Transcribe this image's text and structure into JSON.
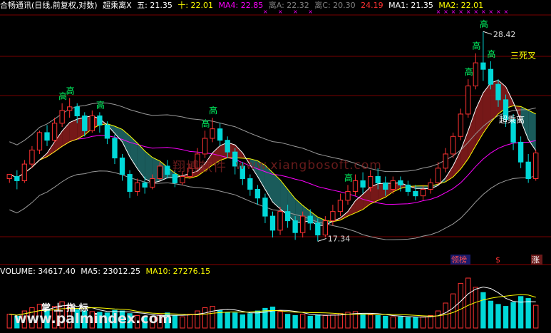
{
  "header": {
    "app_title": "合畅通讯(日线,前复权,对数)",
    "indicator_name": "超乘离X",
    "items": [
      {
        "label": "五: 21.35",
        "color": "#ffffff"
      },
      {
        "label": "十: 22.01",
        "color": "#ffff00"
      },
      {
        "label": "MA4: 22.85",
        "color": "#ff00ff"
      },
      {
        "label": "离A: 22.32",
        "color": "#808080"
      },
      {
        "label": "离C: 20.30",
        "color": "#808080"
      },
      {
        "label": "24.19",
        "color": "#ff3232"
      },
      {
        "label": "MA1: 21.35",
        "color": "#ffffff"
      },
      {
        "label": "MA2: 22.01",
        "color": "#ffff00"
      }
    ]
  },
  "annotations": {
    "high_marker": "高",
    "high_price": "28.42",
    "low_price": "17.34",
    "three_death_cross": "三死叉",
    "over_deviation": "超乘离",
    "tag_signal": "领榜",
    "tag_s": "$",
    "tag_rise": "涨"
  },
  "volume": {
    "label": "VOLUME: 34617.40",
    "ma5": "MA5: 23012.25",
    "ma10": "MA10: 27276.15"
  },
  "watermarks": {
    "software": "翔博软件",
    "url": "www.xiangbosoft.com",
    "bottom_cn": "掌 上 指 标",
    "bottom_url": "www.palmindex.com"
  },
  "colors": {
    "up": "#ff3232",
    "down": "#00d8d8",
    "ma_white": "#ffffff",
    "ma_yellow": "#ffff00",
    "ma_magenta": "#ff00ff",
    "band_gray": "#9a9a9a",
    "fill_red": "#8b1c1c",
    "fill_teal": "#1f6b6b"
  },
  "chart_data": {
    "type": "candlestick",
    "price_scale": "log",
    "ylim": [
      16.5,
      29.5
    ],
    "high": 28.42,
    "low": 17.34,
    "candles": [
      [
        20.1,
        20.3,
        19.9,
        20.2
      ],
      [
        20.2,
        20.0,
        19.6,
        20.5
      ],
      [
        20.0,
        20.8,
        19.9,
        21.0
      ],
      [
        20.8,
        21.5,
        20.6,
        21.7
      ],
      [
        21.5,
        22.4,
        21.3,
        22.5
      ],
      [
        22.4,
        22.0,
        21.7,
        22.8
      ],
      [
        22.0,
        22.9,
        21.9,
        23.2
      ],
      [
        22.9,
        23.6,
        22.7,
        24.0
      ],
      [
        23.6,
        23.8,
        23.2,
        24.3
      ],
      [
        23.8,
        23.3,
        22.9,
        24.0
      ],
      [
        23.3,
        22.5,
        22.2,
        23.5
      ],
      [
        22.5,
        23.3,
        22.4,
        23.6
      ],
      [
        23.3,
        22.8,
        22.4,
        23.5
      ],
      [
        22.8,
        22.1,
        21.8,
        23.0
      ],
      [
        22.1,
        21.1,
        20.8,
        22.3
      ],
      [
        21.1,
        20.3,
        20.0,
        21.3
      ],
      [
        20.3,
        19.5,
        19.2,
        20.5
      ],
      [
        19.5,
        19.9,
        19.3,
        20.1
      ],
      [
        19.9,
        19.7,
        19.4,
        20.2
      ],
      [
        19.7,
        20.1,
        19.6,
        20.3
      ],
      [
        20.1,
        20.7,
        20.0,
        20.9
      ],
      [
        20.7,
        20.3,
        20.1,
        21.0
      ],
      [
        20.3,
        19.9,
        19.7,
        20.5
      ],
      [
        19.9,
        20.2,
        19.8,
        20.4
      ],
      [
        20.2,
        20.6,
        20.1,
        20.8
      ],
      [
        20.6,
        21.3,
        20.5,
        21.6
      ],
      [
        21.3,
        22.1,
        21.1,
        22.5
      ],
      [
        22.1,
        22.6,
        21.9,
        23.2
      ],
      [
        22.6,
        22.0,
        21.7,
        22.9
      ],
      [
        22.0,
        21.4,
        21.1,
        22.2
      ],
      [
        21.4,
        20.7,
        20.3,
        21.6
      ],
      [
        20.7,
        20.1,
        19.8,
        20.9
      ],
      [
        20.1,
        19.6,
        19.3,
        20.3
      ],
      [
        19.6,
        19.2,
        18.9,
        19.8
      ],
      [
        19.2,
        18.4,
        18.1,
        19.4
      ],
      [
        18.4,
        17.8,
        17.5,
        18.6
      ],
      [
        17.8,
        18.6,
        17.6,
        18.8
      ],
      [
        18.6,
        18.2,
        17.9,
        18.9
      ],
      [
        18.2,
        17.7,
        17.4,
        18.4
      ],
      [
        17.7,
        18.4,
        17.5,
        18.6
      ],
      [
        18.4,
        18.1,
        17.8,
        18.7
      ],
      [
        18.1,
        17.6,
        17.34,
        18.3
      ],
      [
        17.6,
        18.2,
        17.5,
        18.4
      ],
      [
        18.2,
        18.6,
        18.0,
        18.9
      ],
      [
        18.6,
        19.1,
        18.4,
        19.4
      ],
      [
        19.1,
        19.5,
        18.9,
        19.8
      ],
      [
        19.5,
        20.0,
        19.3,
        20.3
      ],
      [
        20.0,
        19.7,
        19.4,
        20.4
      ],
      [
        19.7,
        20.2,
        19.5,
        20.5
      ],
      [
        20.2,
        19.9,
        19.6,
        20.6
      ],
      [
        19.9,
        19.6,
        19.3,
        20.2
      ],
      [
        19.6,
        20.0,
        19.4,
        20.2
      ],
      [
        20.0,
        19.8,
        19.5,
        20.2
      ],
      [
        19.8,
        19.5,
        19.3,
        20.0
      ],
      [
        19.5,
        19.3,
        19.1,
        19.8
      ],
      [
        19.3,
        19.6,
        19.1,
        19.8
      ],
      [
        19.6,
        19.9,
        19.4,
        20.1
      ],
      [
        19.9,
        20.6,
        19.8,
        20.9
      ],
      [
        20.6,
        21.3,
        20.4,
        21.6
      ],
      [
        21.3,
        22.2,
        21.1,
        22.4
      ],
      [
        22.2,
        23.4,
        22.0,
        23.7
      ],
      [
        23.4,
        25.0,
        23.2,
        25.4
      ],
      [
        25.0,
        26.4,
        24.8,
        27.0
      ],
      [
        26.4,
        26.0,
        25.3,
        28.42
      ],
      [
        26.0,
        25.1,
        24.8,
        26.5
      ],
      [
        25.1,
        24.2,
        23.8,
        25.4
      ],
      [
        24.2,
        23.1,
        22.7,
        24.5
      ],
      [
        23.1,
        21.9,
        21.5,
        23.4
      ],
      [
        21.9,
        20.9,
        20.6,
        22.2
      ],
      [
        20.9,
        20.1,
        19.9,
        21.3
      ],
      [
        20.1,
        21.35,
        20.0,
        21.5
      ]
    ],
    "series": [
      {
        "name": "五",
        "color": "#ffffff"
      },
      {
        "name": "十",
        "color": "#ffff00"
      },
      {
        "name": "MA4",
        "color": "#ff00ff"
      }
    ],
    "volume": [
      2100,
      1800,
      2600,
      3100,
      3600,
      2900,
      3300,
      4000,
      3500,
      2800,
      2600,
      2500,
      2400,
      2300,
      2700,
      2600,
      2200,
      1900,
      1700,
      1800,
      2000,
      2300,
      1900,
      1700,
      2100,
      2600,
      3100,
      3300,
      2700,
      2400,
      2300,
      2000,
      2200,
      2600,
      3000,
      3200,
      2500,
      2100,
      1900,
      2100,
      1800,
      2000,
      1900,
      2000,
      2200,
      2400,
      2500,
      2100,
      2000,
      1900,
      1800,
      1700,
      1700,
      1600,
      1600,
      1700,
      1900,
      2600,
      3800,
      5200,
      6800,
      7600,
      6200,
      5400,
      4100,
      3600,
      3300,
      3900,
      4800,
      4500,
      3461
    ]
  }
}
